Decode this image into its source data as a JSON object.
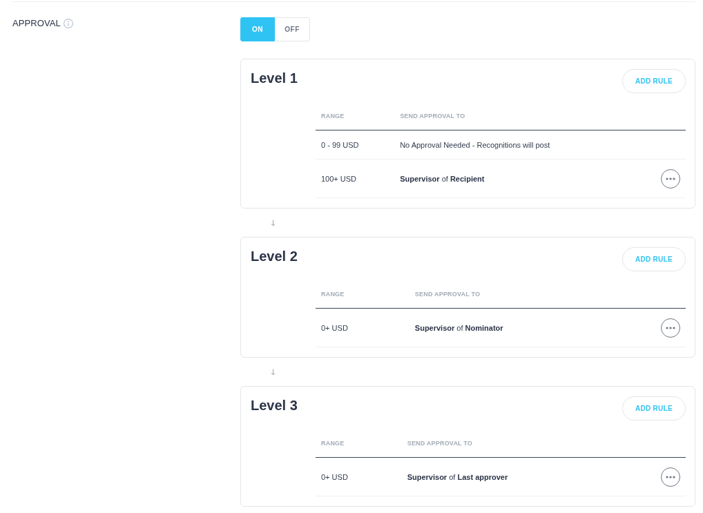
{
  "section": {
    "label": "APPROVAL",
    "toggle": [
      {
        "label": "ON",
        "selected": true
      },
      {
        "label": "OFF",
        "selected": false
      }
    ]
  },
  "levels": [
    {
      "title": "Level 1",
      "button": "ADD RULE",
      "columns": [
        "RANGE",
        "SEND APPROVAL TO"
      ],
      "rows": [
        {
          "range": "0 - 99 USD",
          "send_to": "No Approval Needed - Recognitions will post",
          "menu": false
        },
        {
          "range": "100+ USD",
          "send_to": "**Supervisor** of **Recipient**",
          "menu": true
        }
      ]
    },
    {
      "title": "Level 2",
      "button": "ADD RULE",
      "columns": [
        "RANGE",
        "SEND APPROVAL TO"
      ],
      "rows": [
        {
          "range": "0+ USD",
          "send_to": "**Supervisor** of **Nominator**",
          "menu": true
        }
      ]
    },
    {
      "title": "Level 3",
      "button": "ADD RULE",
      "columns": [
        "RANGE",
        "SEND APPROVAL TO"
      ],
      "rows": [
        {
          "range": "0+ USD",
          "send_to": "**Supervisor** of **Last approver**",
          "menu": true
        }
      ]
    }
  ]
}
